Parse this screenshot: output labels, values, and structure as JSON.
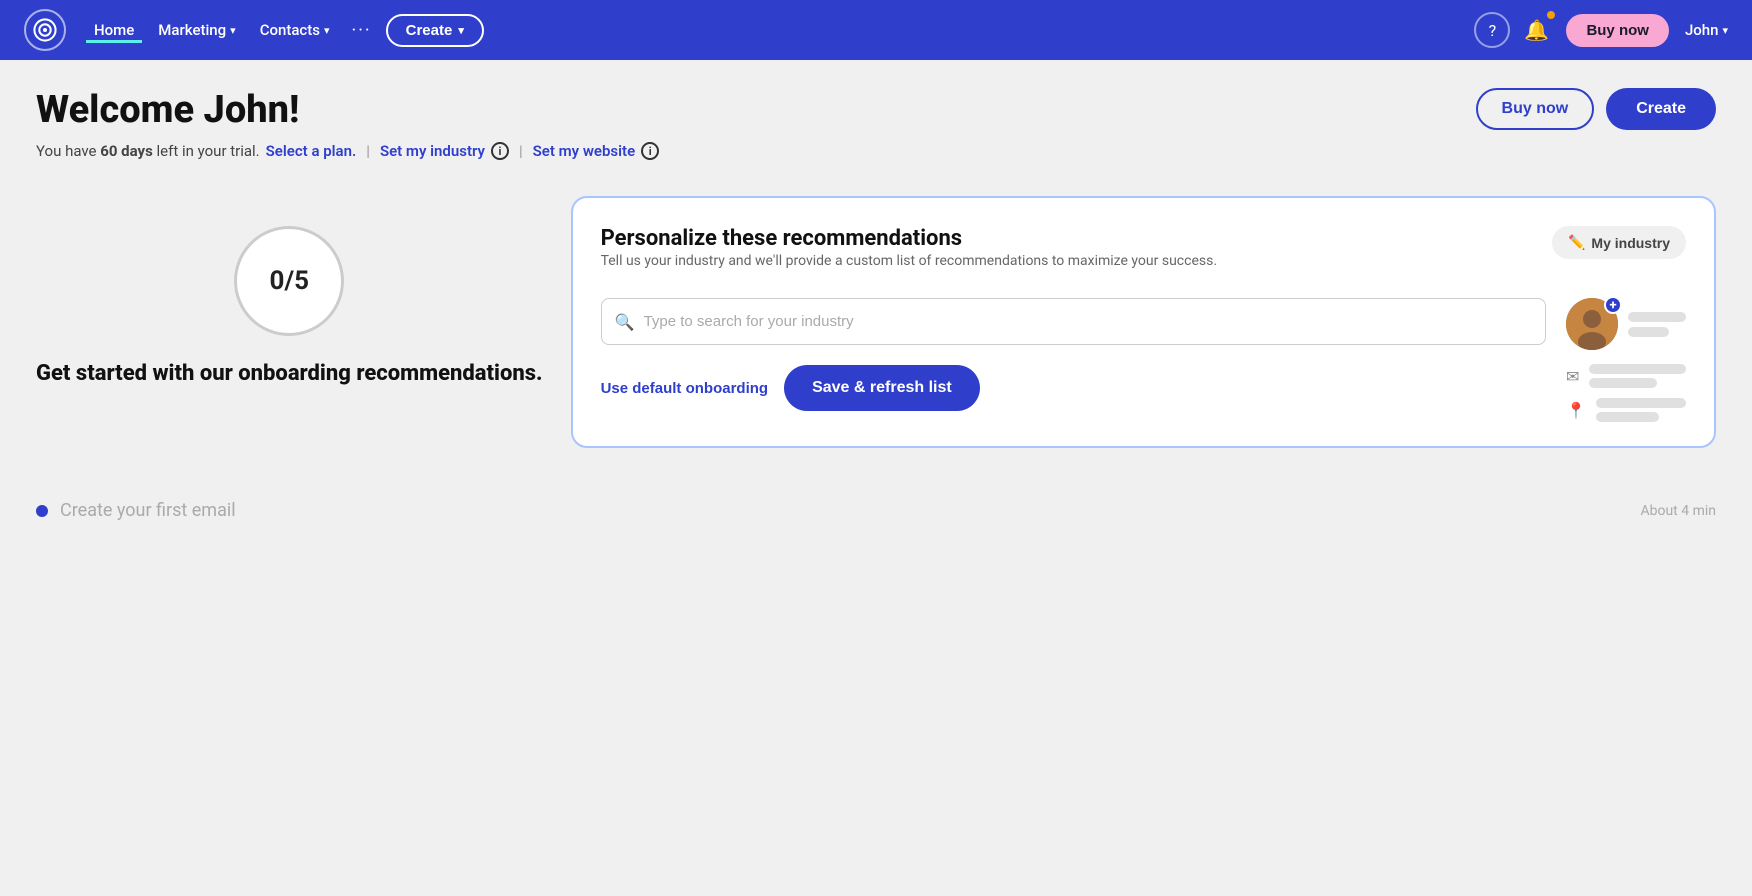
{
  "nav": {
    "logo_alt": "Constant Contact logo",
    "links": [
      {
        "label": "Home",
        "active": true
      },
      {
        "label": "Marketing",
        "has_chevron": true
      },
      {
        "label": "Contacts",
        "has_chevron": true
      }
    ],
    "dots": "···",
    "create_label": "Create",
    "buy_now_label": "Buy now",
    "user_label": "John"
  },
  "header": {
    "welcome": "Welcome John!",
    "trial_prefix": "You have ",
    "trial_bold": "60 days",
    "trial_suffix": " left in your trial.",
    "select_plan_label": "Select a plan.",
    "set_industry_label": "Set my industry",
    "set_website_label": "Set my website",
    "buy_now_btn": "Buy now",
    "create_btn": "Create"
  },
  "left_panel": {
    "progress": "0/5",
    "text": "Get started with our onboarding recommendations."
  },
  "card": {
    "title": "Personalize these recommendations",
    "subtitle": "Tell us your industry and we'll provide a custom list of recommendations to maximize your success.",
    "my_industry_label": "My industry",
    "search_placeholder": "Type to search for your industry",
    "use_default_label": "Use default onboarding",
    "save_refresh_label": "Save & refresh list"
  },
  "bottom": {
    "text": "Create your first email",
    "time": "About 4 min"
  }
}
